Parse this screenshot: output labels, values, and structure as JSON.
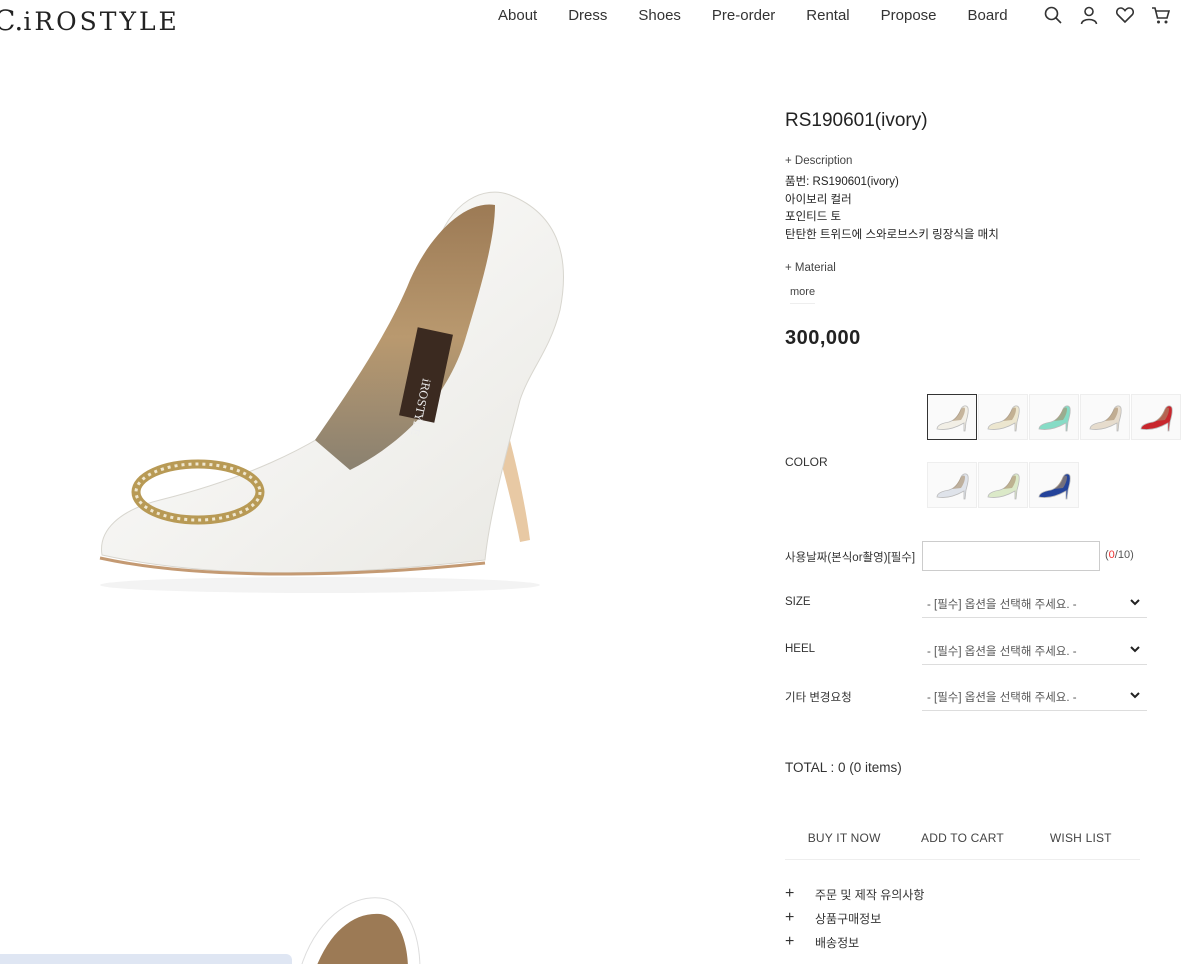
{
  "header": {
    "logo_mark": "C.",
    "logo_text": "iROSTYLE",
    "nav": [
      "About",
      "Dress",
      "Shoes",
      "Pre-order",
      "Rental",
      "Propose",
      "Board"
    ],
    "icons": [
      "search-icon",
      "user-icon",
      "heart-icon",
      "cart-icon"
    ]
  },
  "product": {
    "title": "RS190601(ivory)",
    "description_toggle": "+ Description",
    "description_lines": [
      "품번: RS190601(ivory)",
      "아이보리 컬러",
      "포인티드 토",
      "탄탄한 트위드에 스와로브스키 링장식을 매치"
    ],
    "material_toggle": "+ Material",
    "more_label": "more",
    "price": "300,000"
  },
  "colors": {
    "label": "COLOR",
    "swatches": [
      {
        "name": "ivory",
        "color": "#f2efe6",
        "selected": true
      },
      {
        "name": "cream",
        "color": "#ece6cf",
        "selected": false
      },
      {
        "name": "mint",
        "color": "#86dcc6",
        "selected": false
      },
      {
        "name": "beige",
        "color": "#e6dccd",
        "selected": false
      },
      {
        "name": "red",
        "color": "#c8262d",
        "selected": false
      },
      {
        "name": "silver",
        "color": "#dfe3ea",
        "selected": false
      },
      {
        "name": "light-green",
        "color": "#dbe9c8",
        "selected": false
      },
      {
        "name": "navy-blue",
        "color": "#24439a",
        "selected": false
      }
    ]
  },
  "options": {
    "date_label": "사용날짜(본식or촬영)[필수]",
    "date_value": "",
    "counter_current": "0",
    "counter_total": "/10)",
    "counter_open": "(",
    "size_label": "SIZE",
    "heel_label": "HEEL",
    "other_label": "기타 변경요청",
    "select_placeholder": "- [필수] 옵션을 선택해 주세요. -"
  },
  "total": "TOTAL : 0 (0 items)",
  "actions": {
    "buy_now": "BUY IT NOW",
    "add_to_cart": "ADD TO CART",
    "wish_list": "WISH LIST"
  },
  "accordion": [
    "주문 및 제작 유의사항",
    "상품구매정보",
    "배송정보"
  ]
}
